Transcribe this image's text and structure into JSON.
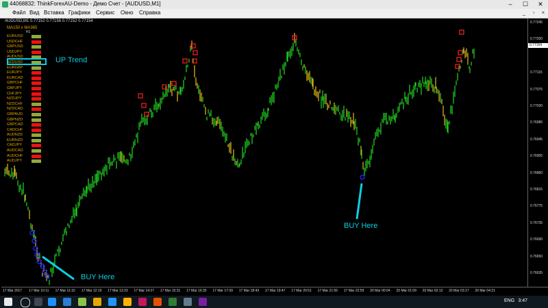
{
  "window": {
    "title": "44068832: ThinkForexAU-Demo - Демо Счет - [AUDUSD,M1]",
    "controls": [
      "–",
      "☐",
      "✕"
    ]
  },
  "menu": [
    "Файл",
    "Вид",
    "Вставка",
    "Графики",
    "Сервис",
    "Окно",
    "Справка"
  ],
  "chart": {
    "symbol_line": "AUDUSD,M1  0.77152 0.77156 0.77152 0.77154",
    "current_price": "0.77154",
    "price_ticks": [
      "0.77245",
      "0.77200",
      "0.77154",
      "0.77115",
      "0.77075",
      "0.77030",
      "0.76985",
      "0.76945",
      "0.76905",
      "0.76860",
      "0.76815",
      "0.76775",
      "0.76735",
      "0.76690",
      "0.76650",
      "0.76635"
    ],
    "time_ticks": [
      "17 Mar 2017",
      "17 Mar 10:11",
      "17 Mar 11:15",
      "17 Mar 12:19",
      "17 Mar 13:23",
      "17 Mar 14:27",
      "17 Mar 15:31",
      "17 Mar 16:35",
      "17 Mar 17:39",
      "17 Mar 18:43",
      "17 Mar 19:47",
      "17 Mar 20:51",
      "17 Mar 21:55",
      "17 Mar 22:59",
      "20 Mar 00:04",
      "20 Mar 01:09",
      "20 Mar 02:13",
      "20 Mar 03:17",
      "20 Mar 04:21"
    ],
    "colors": {
      "up": "#22dd22",
      "down": "#e4c01a",
      "sell_marker": "#ff2222",
      "buy_marker": "#2222ff",
      "annotation": "#0bd0e0"
    }
  },
  "heatmap": {
    "header": "MA150  x  MA365",
    "timeframe": "H1",
    "rows": [
      {
        "pair": "EURUSD",
        "color": "#8faa3a"
      },
      {
        "pair": "USDCHF",
        "color": "#ee1111"
      },
      {
        "pair": "GBPUSD",
        "color": "#8faa3a"
      },
      {
        "pair": "USDJPY",
        "color": "#ee1111"
      },
      {
        "pair": "AUDUSD",
        "color": "#8faa3a"
      },
      {
        "pair": "NZDUSD",
        "color": "#8faa3a"
      },
      {
        "pair": "EURGBP",
        "color": "#8faa3a"
      },
      {
        "pair": "EURJPY",
        "color": "#ee1111"
      },
      {
        "pair": "EURCAD",
        "color": "#ee1111"
      },
      {
        "pair": "GBPCHF",
        "color": "#ee1111"
      },
      {
        "pair": "GBPJPY",
        "color": "#ee1111"
      },
      {
        "pair": "CHFJPY",
        "color": "#ee1111"
      },
      {
        "pair": "NZDJPY",
        "color": "#ee1111"
      },
      {
        "pair": "NZDCHF",
        "color": "#8faa3a"
      },
      {
        "pair": "NZDCAD",
        "color": "#ee1111"
      },
      {
        "pair": "GBPAUD",
        "color": "#8faa3a"
      },
      {
        "pair": "GBPNZD",
        "color": "#8faa3a"
      },
      {
        "pair": "GBPCAD",
        "color": "#ee1111"
      },
      {
        "pair": "CADCHF",
        "color": "#ee1111"
      },
      {
        "pair": "AUDNZD",
        "color": "#8faa3a"
      },
      {
        "pair": "EURNZD",
        "color": "#8faa3a"
      },
      {
        "pair": "CADJPY",
        "color": "#ee1111"
      },
      {
        "pair": "AUDCAD",
        "color": "#8faa3a"
      },
      {
        "pair": "AUDCHF",
        "color": "#ee1111"
      },
      {
        "pair": "AUDJPY",
        "color": "#8faa3a"
      }
    ]
  },
  "annotations": {
    "up_trend": "UP Trend",
    "buy_left": "BUY Here",
    "buy_right": "BUY Here"
  },
  "taskbar": {
    "language": "ENG",
    "time": "3:47"
  }
}
